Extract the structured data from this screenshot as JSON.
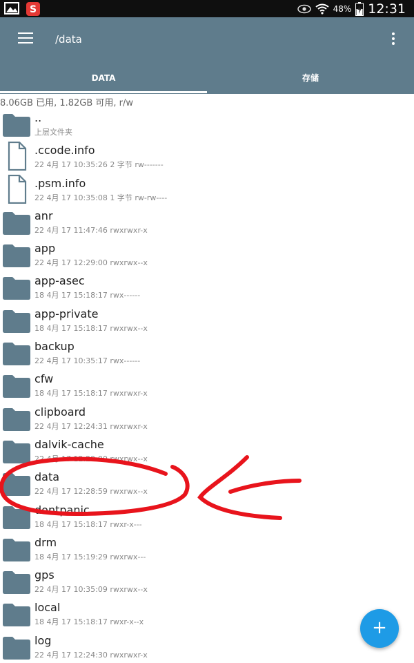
{
  "status_bar": {
    "battery": "48%",
    "time": "12:31",
    "icons": [
      "gallery-icon",
      "sogou-input-icon",
      "eye-icon",
      "wifi-icon",
      "battery-charging-icon"
    ]
  },
  "app_bar": {
    "path": "/data",
    "tabs": [
      {
        "label": "DATA",
        "selected": true
      },
      {
        "label": "存储",
        "selected": false
      }
    ]
  },
  "storage_info": "8.06GB 已用, 1.82GB 可用, r/w",
  "files": [
    {
      "name": "..",
      "meta": "上层文件夹",
      "type": "folder"
    },
    {
      "name": ".ccode.info",
      "meta": "22 4月 17 10:35:26   2 字节   rw-------",
      "type": "file"
    },
    {
      "name": ".psm.info",
      "meta": "22 4月 17 10:35:08   1 字节   rw-rw----",
      "type": "file"
    },
    {
      "name": "anr",
      "meta": "22 4月 17 11:47:46    rwxrwxr-x",
      "type": "folder"
    },
    {
      "name": "app",
      "meta": "22 4月 17 12:29:00    rwxrwx--x",
      "type": "folder"
    },
    {
      "name": "app-asec",
      "meta": "18 4月 17 15:18:17    rwx------",
      "type": "folder"
    },
    {
      "name": "app-private",
      "meta": "18 4月 17 15:18:17    rwxrwx--x",
      "type": "folder"
    },
    {
      "name": "backup",
      "meta": "22 4月 17 10:35:17    rwx------",
      "type": "folder"
    },
    {
      "name": "cfw",
      "meta": "18 4月 17 15:18:17    rwxrwxr-x",
      "type": "folder"
    },
    {
      "name": "clipboard",
      "meta": "22 4月 17 12:24:31    rwxrwxr-x",
      "type": "folder"
    },
    {
      "name": "dalvik-cache",
      "meta": "22 4月 17 12:29:00    rwxrwx--x",
      "type": "folder"
    },
    {
      "name": "data",
      "meta": "22 4月 17 12:28:59    rwxrwx--x",
      "type": "folder"
    },
    {
      "name": "dontpanic",
      "meta": "18 4月 17 15:18:17    rwxr-x---",
      "type": "folder"
    },
    {
      "name": "drm",
      "meta": "18 4月 17 15:19:29    rwxrwx---",
      "type": "folder"
    },
    {
      "name": "gps",
      "meta": "22 4月 17 10:35:09    rwxrwx--x",
      "type": "folder"
    },
    {
      "name": "local",
      "meta": "18 4月 17 15:18:17    rwxr-x--x",
      "type": "folder"
    },
    {
      "name": "log",
      "meta": "22 4月 17 12:24:30    rwxrwxr-x",
      "type": "folder"
    }
  ],
  "fab": {
    "label": "+"
  },
  "colors": {
    "app_bar": "#5f7c8c",
    "folder": "#5f7c8c",
    "fab": "#1e9be6",
    "annotation": "#e8141c"
  }
}
